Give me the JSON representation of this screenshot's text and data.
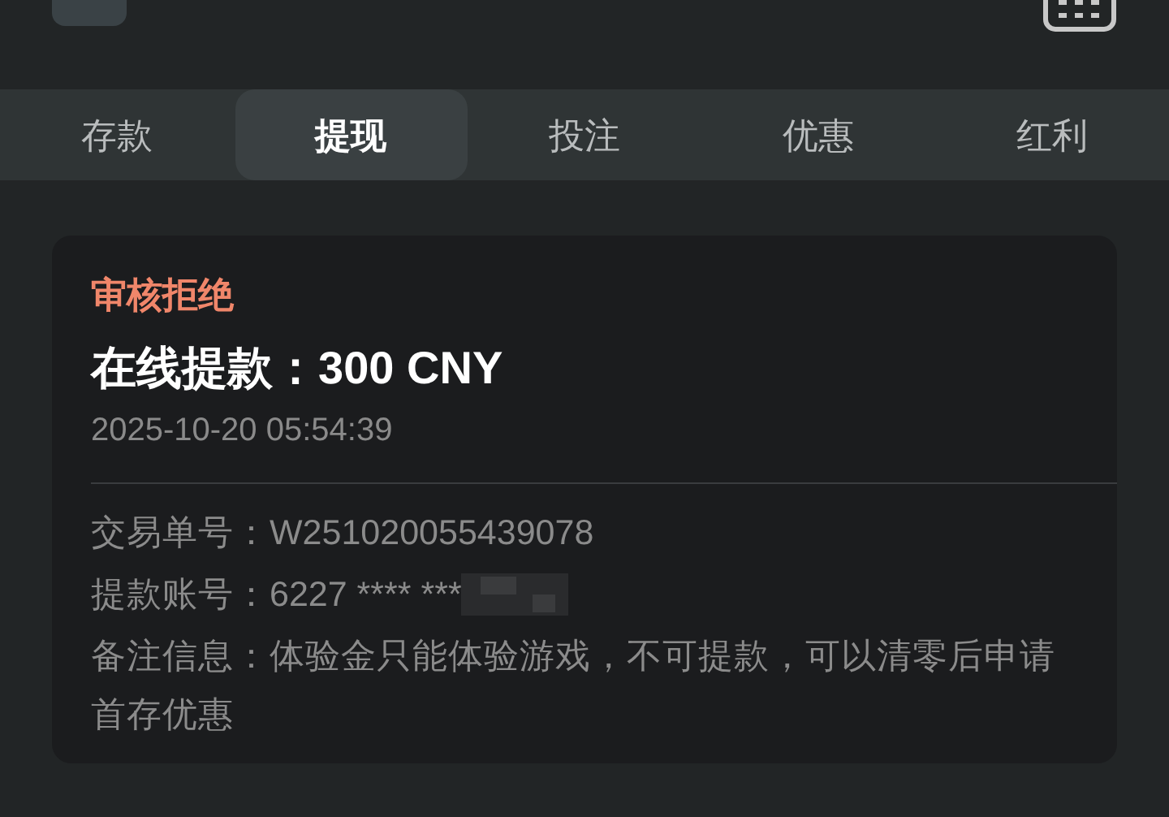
{
  "tabs": [
    {
      "label": "存款",
      "selected": false
    },
    {
      "label": "提现",
      "selected": true
    },
    {
      "label": "投注",
      "selected": false
    },
    {
      "label": "优惠",
      "selected": false
    },
    {
      "label": "红利",
      "selected": false
    }
  ],
  "record": {
    "status": "审核拒绝",
    "title": "在线提款：300 CNY",
    "time": "2025-10-20 05:54:39",
    "details": [
      {
        "label": "交易单号：",
        "value": "W251020055439078",
        "redacted": false
      },
      {
        "label": "提款账号：",
        "value": "6227 **** ***",
        "redacted": true
      },
      {
        "label": "备注信息：",
        "value": "体验金只能体验游戏，不可提款，可以清零后申请首存优惠",
        "redacted": false
      }
    ]
  }
}
